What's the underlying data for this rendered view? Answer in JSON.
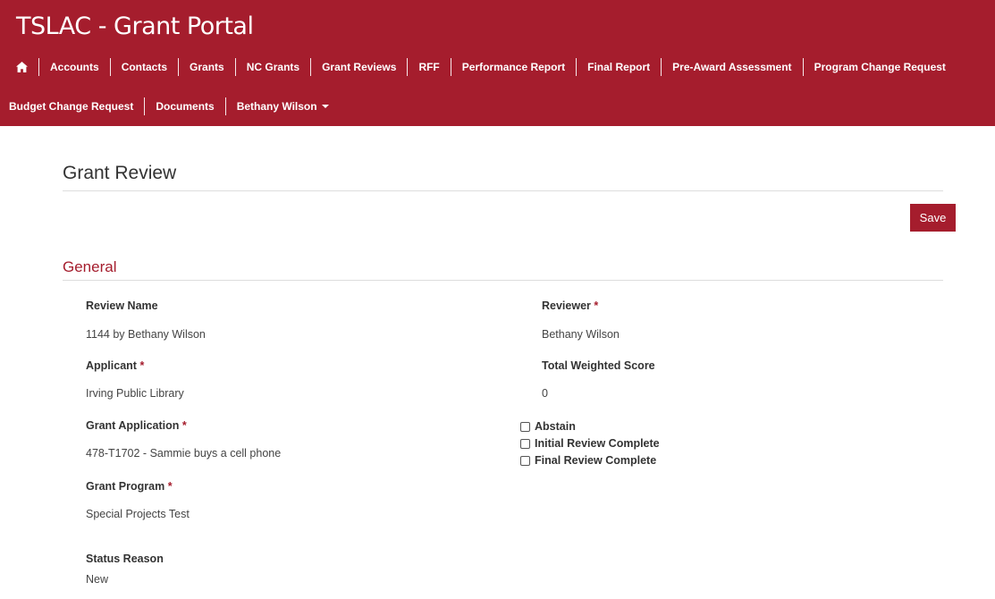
{
  "header": {
    "title": "TSLAC - Grant Portal",
    "nav_row1": [
      "Accounts",
      "Contacts",
      "Grants",
      "NC Grants",
      "Grant Reviews",
      "RFF",
      "Performance Report",
      "Final Report",
      "Pre-Award Assessment",
      "Program Change Request"
    ],
    "nav_row2": [
      "Budget Change Request",
      "Documents"
    ],
    "user_menu": "Bethany Wilson",
    "brand_color": "#a51d2d"
  },
  "page": {
    "title": "Grant Review",
    "save_label": "Save"
  },
  "section": {
    "title": "General"
  },
  "fields": {
    "review_name_label": "Review Name",
    "review_name_value": "1144 by Bethany Wilson",
    "applicant_label": "Applicant",
    "applicant_value": "Irving Public Library",
    "grant_application_label": "Grant Application",
    "grant_application_value": "478-T1702 - Sammie buys a cell phone",
    "grant_program_label": "Grant Program",
    "grant_program_value": "Special Projects Test",
    "status_reason_label": "Status Reason",
    "status_reason_value": "New",
    "reviewer_label": "Reviewer",
    "reviewer_value": "Bethany Wilson",
    "total_score_label": "Total Weighted Score",
    "total_score_value": "0",
    "required_marker": "*"
  },
  "checkboxes": {
    "abstain": "Abstain",
    "initial_review": "Initial Review Complete",
    "final_review": "Final Review Complete"
  }
}
